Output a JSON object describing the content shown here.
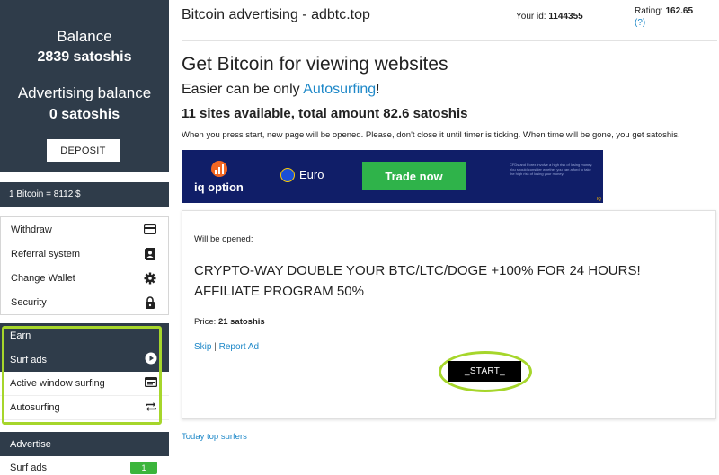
{
  "header": {
    "site_title": "Bitcoin advertising - adbtc.top",
    "user_id_label": "Your id:",
    "user_id_value": "1144355",
    "rating_label": "Rating:",
    "rating_value": "162.65",
    "rating_help": "(?)"
  },
  "sidebar": {
    "balance_label": "Balance",
    "balance_value": "2839 satoshis",
    "ad_balance_label": "Advertising balance",
    "ad_balance_value": "0 satoshis",
    "deposit_label": "DEPOSIT",
    "rate_text": "1 Bitcoin = 8112 $",
    "menu": [
      {
        "label": "Withdraw",
        "icon": "credit-card-icon"
      },
      {
        "label": "Referral system",
        "icon": "contacts-icon"
      },
      {
        "label": "Change Wallet",
        "icon": "gear-icon"
      },
      {
        "label": "Security",
        "icon": "lock-icon"
      }
    ],
    "earn_header": "Earn",
    "earn_items": [
      {
        "label": "Surf ads",
        "icon": "play-circle-icon",
        "active": true
      },
      {
        "label": "Active window surfing",
        "icon": "window-icon",
        "active": false
      },
      {
        "label": "Autosurfing",
        "icon": "repeat-icon",
        "active": false
      }
    ],
    "advertise_header": "Advertise",
    "advertise_items": [
      {
        "label": "Surf ads",
        "badge": "1"
      }
    ]
  },
  "main": {
    "heading": "Get Bitcoin for viewing websites",
    "subheading_prefix": "Easier can be only ",
    "subheading_link": "Autosurfing",
    "subheading_suffix": "!",
    "sites_info": "11 sites available, total amount 82.6 satoshis",
    "instructions": "When you press start, new page will be opened. Please, don't close it until timer is ticking. When time will be gone, you get satoshis.",
    "banner": {
      "brand": "iq option",
      "asset": "Euro",
      "cta": "Trade now",
      "disclaimer": "CFDs and Forex involve a high risk of losing money. You should consider whether you can afford to take the high risk of losing your money.",
      "mark": "IQ"
    },
    "card": {
      "will_open_label": "Will be opened:",
      "ad_title": "CRYPTO-WAY DOUBLE YOUR BTC/LTC/DOGE +100% FOR 24 HOURS! AFFILIATE PROGRAM 50%",
      "price_label": "Price:",
      "price_value": "21 satoshis",
      "skip_label": "Skip",
      "separator": " | ",
      "report_label": "Report Ad",
      "start_label": "_START_"
    },
    "top_surfers_label": "Today top surfers"
  },
  "colors": {
    "sidebar_dark": "#2f3c4a",
    "link": "#1e88c8",
    "highlight": "#a6d62b",
    "badge": "#3bb53b"
  }
}
